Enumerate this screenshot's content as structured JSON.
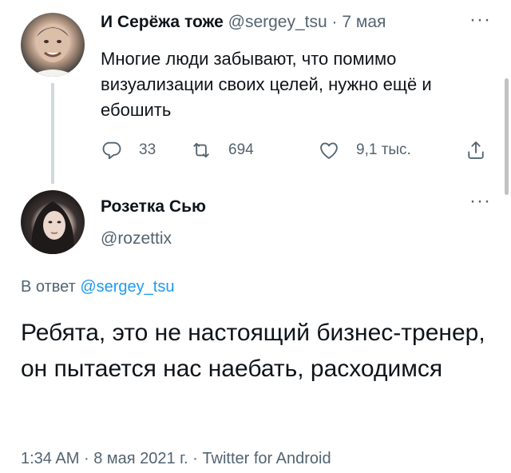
{
  "parent_tweet": {
    "author_name": "И Серёжа тоже",
    "author_handle": "@sergey_tsu",
    "separator": "·",
    "date": "7 мая",
    "text": "Многие люди забывают, что помимо визуализации своих целей, нужно ещё и ебошить",
    "more_icon": "more-horizontal-icon",
    "actions": {
      "replies": "33",
      "retweets": "694",
      "likes": "9,1 тыс."
    }
  },
  "main_tweet": {
    "author_name": "Розетка Сью",
    "author_handle": "@rozettix",
    "reply_prefix": "В ответ",
    "reply_mention": "@sergey_tsu",
    "text": "Ребята, это не настоящий бизнес-тренер, он пытается нас наебать, расходимся",
    "time": "1:34 AM",
    "date": "8 мая 2021 г.",
    "source": "Twitter for Android",
    "separator": "·",
    "more_icon": "more-horizontal-icon"
  },
  "colors": {
    "text": "#0f1419",
    "secondary": "#536471",
    "link": "#1d9bf0",
    "thread_line": "#cfd9de"
  }
}
